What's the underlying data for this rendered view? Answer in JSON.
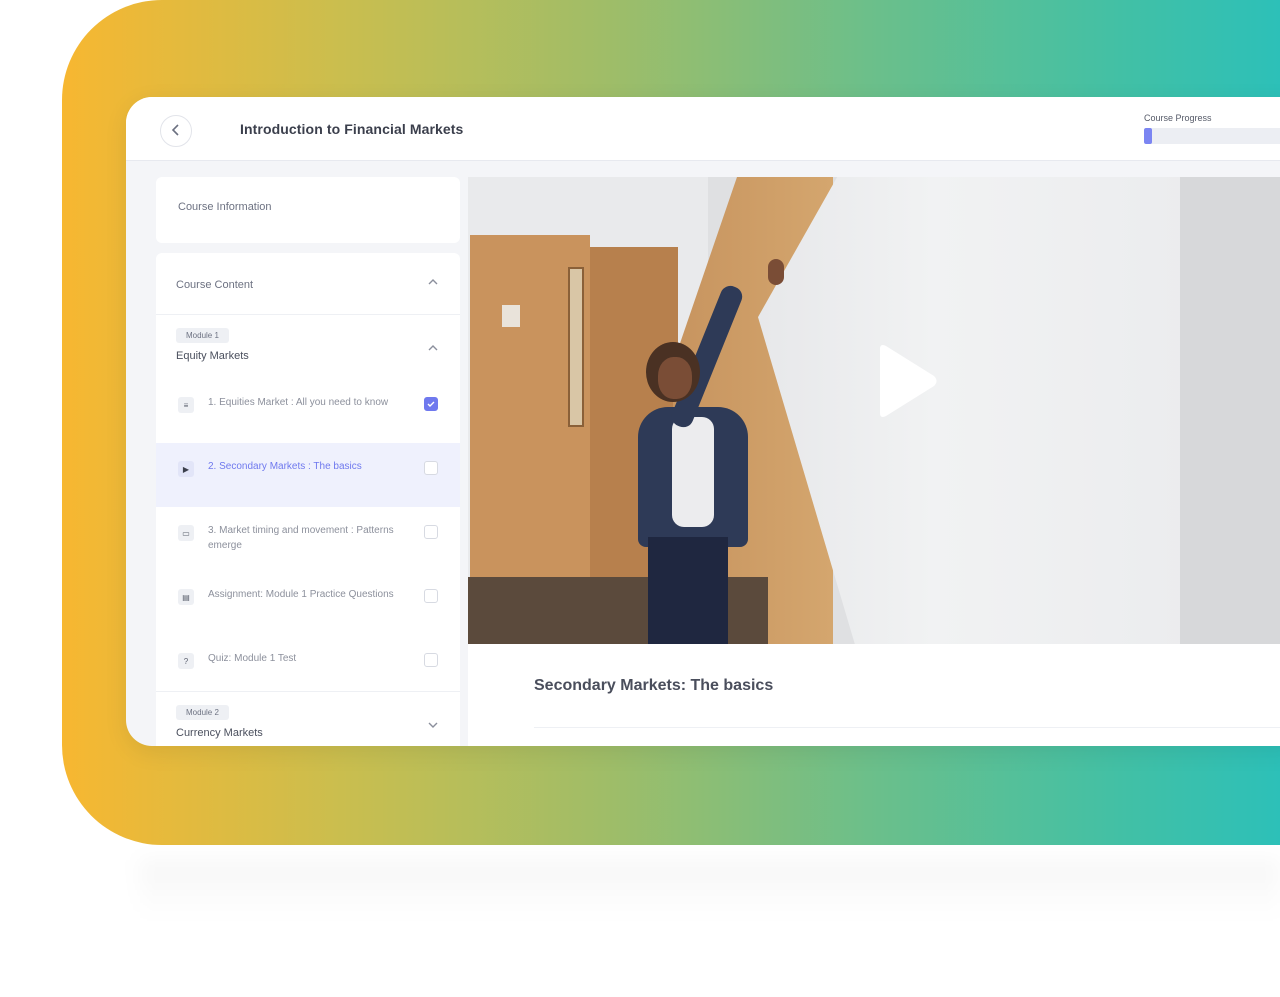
{
  "header": {
    "back_icon": "chevron-left-icon",
    "title": "Introduction to Financial Markets",
    "progress_label": "Course Progress",
    "progress_fraction": 0.05
  },
  "sidebar": {
    "info_label": "Course Information",
    "content_label": "Course Content",
    "module1": {
      "badge": "Module 1",
      "title": "Equity Markets",
      "lessons": [
        {
          "icon": "document-icon",
          "glyph": "≡",
          "label": "1. Equities Market : All you need to know",
          "done": true
        },
        {
          "icon": "play-icon",
          "glyph": "▶",
          "label": "2. Secondary Markets : The basics",
          "done": false,
          "active": true
        },
        {
          "icon": "document-icon",
          "glyph": "▭",
          "label": "3. Market timing and movement : Patterns emerge",
          "done": false
        },
        {
          "icon": "assignment-icon",
          "glyph": "▤",
          "label": "Assignment: Module 1 Practice Questions",
          "done": false
        },
        {
          "icon": "quiz-icon",
          "glyph": "?",
          "label": "Quiz: Module 1 Test",
          "done": false
        }
      ]
    },
    "module2": {
      "badge": "Module 2",
      "title": "Currency Markets"
    }
  },
  "main": {
    "lesson_title": "Secondary Markets: The basics",
    "play_icon": "play-icon"
  },
  "colors": {
    "accent": "#6f79ee",
    "gradient_start": "#f7b731",
    "gradient_end": "#22c0c2"
  }
}
